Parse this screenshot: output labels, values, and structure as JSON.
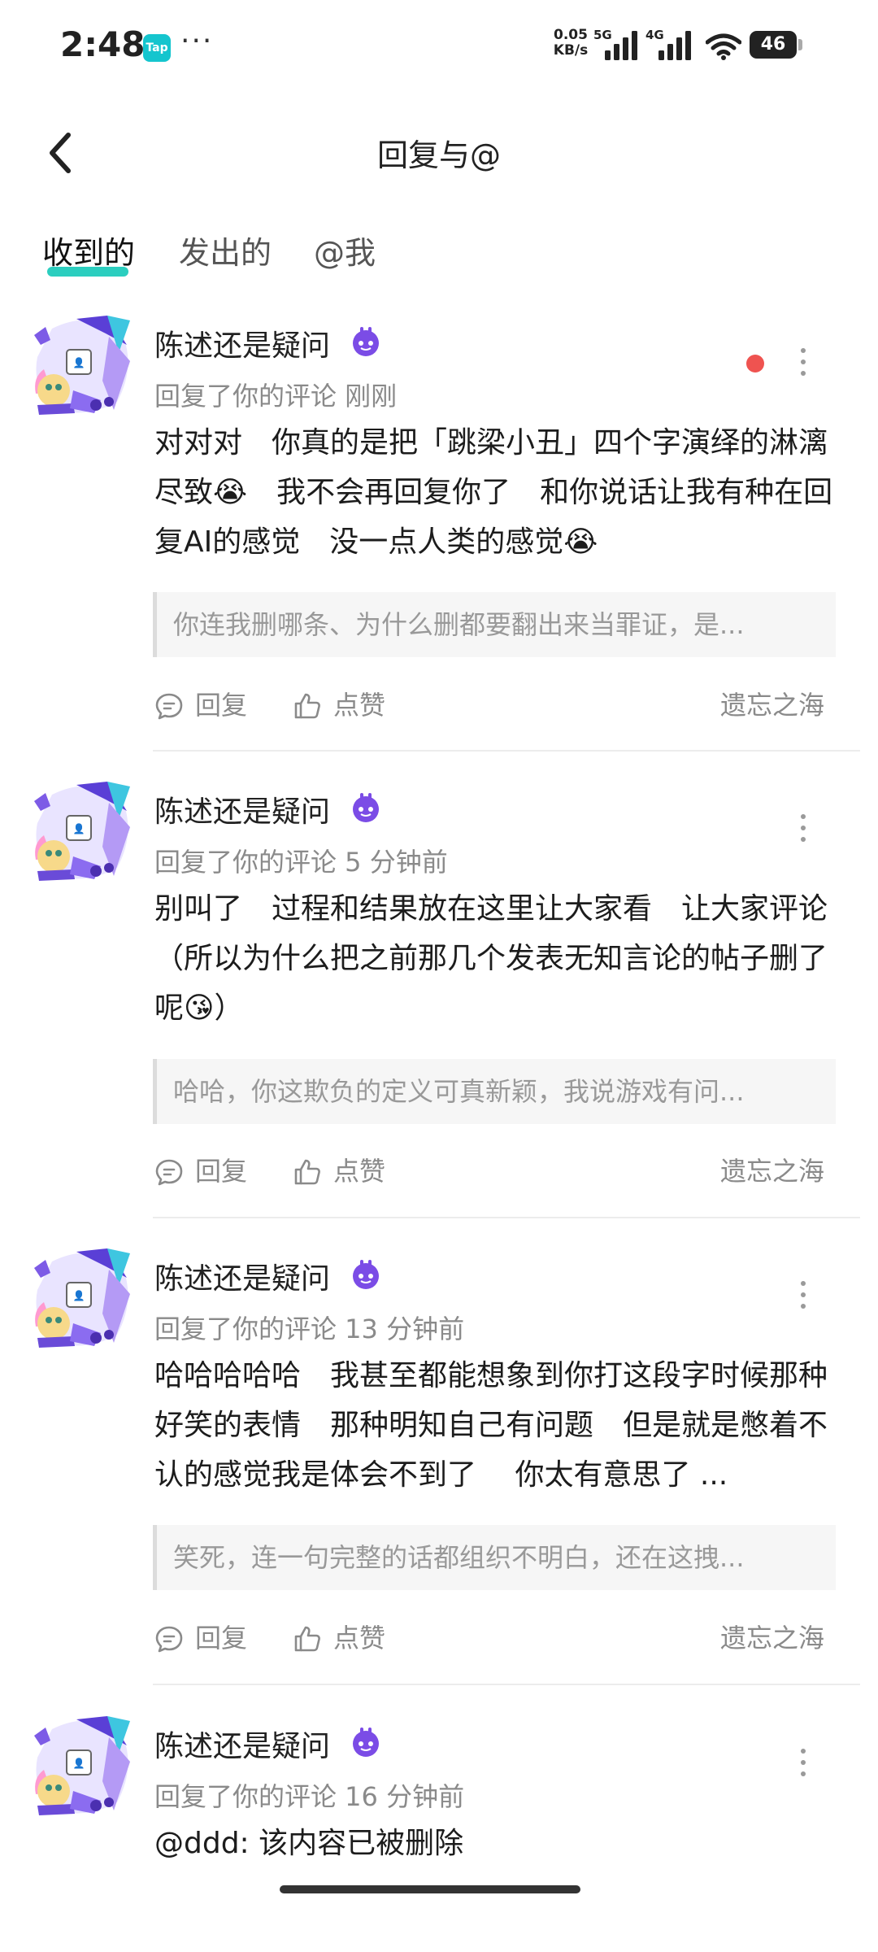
{
  "status_bar": {
    "time": "2:48",
    "app_icon_label": "Tap",
    "more": "···",
    "net_speed_value": "0.05",
    "net_speed_unit": "KB/s",
    "net_5g": "5G",
    "net_4g": "4G",
    "battery": "46"
  },
  "header": {
    "title": "回复与@",
    "back_icon": "chevron-left-icon"
  },
  "tabs": [
    {
      "label": "收到的",
      "active": true
    },
    {
      "label": "发出的",
      "active": false
    },
    {
      "label": "@我",
      "active": false
    }
  ],
  "accent_color": "#14c9b8",
  "unread_color": "#ef5350",
  "items": [
    {
      "username": "陈述还是疑问",
      "meta": "回复了你的评论 刚刚",
      "unread": true,
      "body": "对对对　你真的是把「跳梁小丑」四个字演绎的淋漓尽致😭　我不会再回复你了　和你说话让我有种在回复AI的感觉　没一点人类的感觉😭",
      "quote": "你连我删哪条、为什么删都要翻出来当罪证，是...",
      "reply_label": "回复",
      "like_label": "点赞",
      "source": "遗忘之海"
    },
    {
      "username": "陈述还是疑问",
      "meta": "回复了你的评论 5 分钟前",
      "unread": false,
      "body": "别叫了　过程和结果放在这里让大家看　让大家评论（所以为什么把之前那几个发表无知言论的帖子删了呢😘）",
      "quote": "哈哈，你这欺负的定义可真新颖，我说游戏有问...",
      "reply_label": "回复",
      "like_label": "点赞",
      "source": "遗忘之海"
    },
    {
      "username": "陈述还是疑问",
      "meta": "回复了你的评论 13 分钟前",
      "unread": false,
      "body": "哈哈哈哈哈　我甚至都能想象到你打这段字时候那种好笑的表情　那种明知自己有问题　但是就是憋着不认的感觉我是体会不到了　 你太有意思了 ...",
      "quote": "笑死，连一句完整的话都组织不明白，还在这拽...",
      "reply_label": "回复",
      "like_label": "点赞",
      "source": "遗忘之海"
    },
    {
      "username": "陈述还是疑问",
      "meta": "回复了你的评论 16 分钟前",
      "unread": false,
      "body": "@ddd: 该内容已被删除"
    }
  ]
}
